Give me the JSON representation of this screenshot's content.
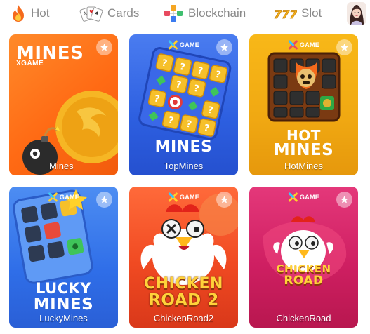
{
  "tabs": [
    {
      "label": "Hot",
      "icon": "flame-icon"
    },
    {
      "label": "Cards",
      "icon": "playing-cards-icon"
    },
    {
      "label": "Blockchain",
      "icon": "blockchain-cubes-icon"
    },
    {
      "label": "Slot",
      "icon": "slot-777-icon"
    }
  ],
  "games": [
    {
      "name": "Mines",
      "title": "MINES",
      "subtitle": "XGAME"
    },
    {
      "name": "TopMines",
      "title": "MINES",
      "brand": "GAME"
    },
    {
      "name": "HotMines",
      "title_line1": "HOT",
      "title_line2": "MINES",
      "brand": "GAME"
    },
    {
      "name": "LuckyMines",
      "title_line1": "LUCKY",
      "title_line2": "MINES",
      "brand": "GAME"
    },
    {
      "name": "ChickenRoad2",
      "title_line1": "CHICKEN",
      "title_line2": "ROAD 2",
      "brand": "GAME"
    },
    {
      "name": "ChickenRoad",
      "title_line1": "CHICKEN",
      "title_line2": "ROAD",
      "brand": "GAME"
    }
  ],
  "colors": {
    "tab_text": "#8a8a8a",
    "mines_bg": "#ff6a14",
    "topmines_bg": "#2d5fe0",
    "hotmines_bg": "#f0a812",
    "luckymines_bg": "#2f6ee8",
    "chickenroad2_bg": "#f04a22",
    "chickenroad_bg": "#cf1f62"
  }
}
